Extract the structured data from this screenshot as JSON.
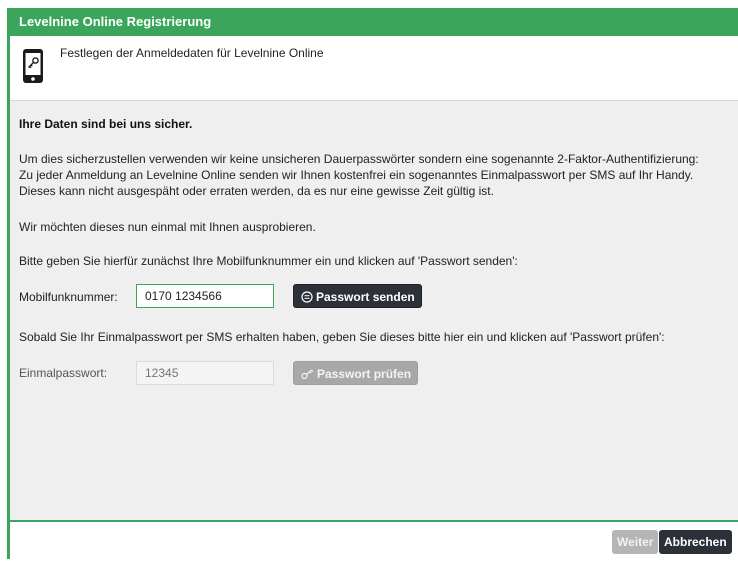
{
  "window": {
    "title": "Levelnine Online Registrierung",
    "subtitle": "Festlegen der Anmeldedaten für Levelnine Online",
    "icon": "mobile-phone-key-icon"
  },
  "content": {
    "heading": "Ihre Daten sind bei uns sicher.",
    "intro_lines": [
      "Um dies sicherzustellen verwenden wir keine unsicheren Dauerpasswörter sondern eine sogenannte 2-Faktor-Authentifizierung:",
      "Zu jeder Anmeldung an Levelnine Online senden wir Ihnen kostenfrei ein sogenanntes Einmalpasswort per SMS auf Ihr Handy.",
      "Dieses kann nicht ausgespäht oder erraten werden, da es nur eine gewisse Zeit gültig ist."
    ],
    "try_text": "Wir möchten dieses nun einmal mit Ihnen ausprobieren.",
    "instruction_send": "Bitte geben Sie hierfür zunächst Ihre Mobilfunknummer ein und klicken auf 'Passwort senden':",
    "mobile_label": "Mobilfunknummer:",
    "mobile_value": "0170 1234566",
    "send_button": "Passwort senden",
    "instruction_check": "Sobald Sie Ihr Einmalpasswort per SMS erhalten haben, geben Sie dieses bitte hier ein und klicken auf 'Passwort prüfen':",
    "otp_label": "Einmalpasswort:",
    "otp_placeholder": "12345",
    "check_button": "Passwort prüfen"
  },
  "footer": {
    "next_button": "Weiter",
    "cancel_button": "Abbrechen"
  },
  "colors": {
    "accent": "#3aa55b",
    "dark_button": "#2c3038",
    "disabled_button": "#a8a8a8",
    "content_bg": "#efefef"
  }
}
